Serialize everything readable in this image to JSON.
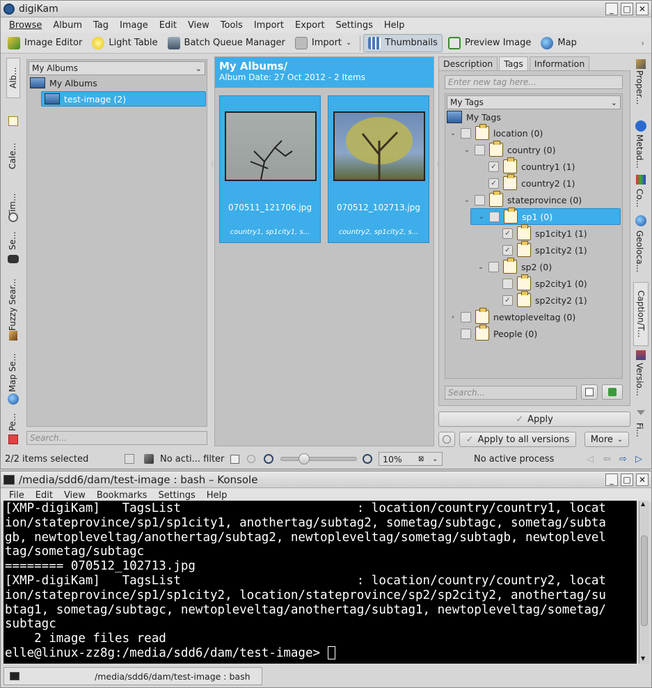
{
  "digikam": {
    "title": "digiKam",
    "window_buttons": [
      "_",
      "□",
      "✕"
    ],
    "menu": [
      "Browse",
      "Album",
      "Tag",
      "Image",
      "Edit",
      "View",
      "Tools",
      "Import",
      "Export",
      "Settings",
      "Help"
    ],
    "toolbar": {
      "image_editor": "Image Editor",
      "light_table": "Light Table",
      "batch_queue": "Batch Queue Manager",
      "import": "Import",
      "thumbnails": "Thumbnails",
      "preview_image": "Preview Image",
      "map": "Map"
    },
    "left_tabs": [
      "Alb...",
      "Cale...",
      "Tim...",
      "Se...",
      "Fuzzy Sear...",
      "Map Se...",
      "Pe..."
    ],
    "right_tabs": [
      "Proper...",
      "Metad...",
      "Co...",
      "Geoloca...",
      "Caption/T...",
      "Versio...",
      "Fi..."
    ],
    "albums": {
      "combo": "My Albums",
      "root": "My Albums",
      "child": "test-image (2)",
      "search_placeholder": "Search..."
    },
    "icon_view": {
      "header_title": "My Albums/",
      "header_sub": "Album Date: 27 Oct 2012 - 2 Items",
      "items": [
        {
          "name": "070511_121706.jpg",
          "tags": "country1, sp1city1, s..."
        },
        {
          "name": "070512_102713.jpg",
          "tags": "country2, sp1city2, s..."
        }
      ]
    },
    "tags_panel": {
      "tabs": [
        "Description",
        "Tags",
        "Information"
      ],
      "new_tag_placeholder": "Enter new tag here...",
      "combo": "My Tags",
      "tree_root": "My Tags",
      "tree": [
        {
          "label": "location (0)",
          "level": 0,
          "arrow": "⌄",
          "checked": false
        },
        {
          "label": "country (0)",
          "level": 1,
          "arrow": "⌄",
          "checked": false
        },
        {
          "label": "country1 (1)",
          "level": 2,
          "arrow": "",
          "checked": true
        },
        {
          "label": "country2 (1)",
          "level": 2,
          "arrow": "",
          "checked": true
        },
        {
          "label": "stateprovince (0)",
          "level": 1,
          "arrow": "⌄",
          "checked": false
        },
        {
          "label": "sp1 (0)",
          "level": 2,
          "arrow": "⌄",
          "checked": false,
          "selected": true
        },
        {
          "label": "sp1city1 (1)",
          "level": 3,
          "arrow": "",
          "checked": true
        },
        {
          "label": "sp1city2 (1)",
          "level": 3,
          "arrow": "",
          "checked": true
        },
        {
          "label": "sp2 (0)",
          "level": 2,
          "arrow": "⌄",
          "checked": false
        },
        {
          "label": "sp2city1 (0)",
          "level": 3,
          "arrow": "",
          "checked": false
        },
        {
          "label": "sp2city2 (1)",
          "level": 3,
          "arrow": "",
          "checked": true
        },
        {
          "label": "newtopleveltag (0)",
          "level": 0,
          "arrow": "›",
          "checked": false
        },
        {
          "label": "People (0)",
          "level": 0,
          "arrow": "",
          "checked": false
        }
      ],
      "search_placeholder": "Search...",
      "apply": "Apply",
      "apply_all": "Apply to all versions",
      "more": "More"
    },
    "status": {
      "selected": "2/2 items selected",
      "filter": "No acti... filter",
      "zoom": "10%",
      "process": "No active process"
    }
  },
  "konsole": {
    "title": "/media/sdd6/dam/test-image : bash – Konsole",
    "window_buttons": [
      "_",
      "□",
      "✕"
    ],
    "menu": [
      "File",
      "Edit",
      "View",
      "Bookmarks",
      "Settings",
      "Help"
    ],
    "lines": [
      "[XMP-digiKam]   TagsList                        : location/country/country1, locat",
      "ion/stateprovince/sp1/sp1city1, anothertag/subtag2, sometag/subtagc, sometag/subta",
      "gb, newtopleveltag/anothertag/subtag2, newtopleveltag/sometag/subtagb, newtoplevel",
      "tag/sometag/subtagc",
      "======== 070512_102713.jpg",
      "[XMP-digiKam]   TagsList                        : location/country/country2, locat",
      "ion/stateprovince/sp1/sp1city2, location/stateprovince/sp2/sp2city2, anothertag/su",
      "btag1, sometag/subtagc, newtopleveltag/anothertag/subtag1, newtopleveltag/sometag/",
      "subtagc",
      "    2 image files read",
      "elle@linux-zz8g:/media/sdd6/dam/test-image> "
    ],
    "tab_label": "/media/sdd6/dam/test-image : bash"
  },
  "colors": {
    "selection": "#3daee9",
    "accent": "#3daee9"
  }
}
